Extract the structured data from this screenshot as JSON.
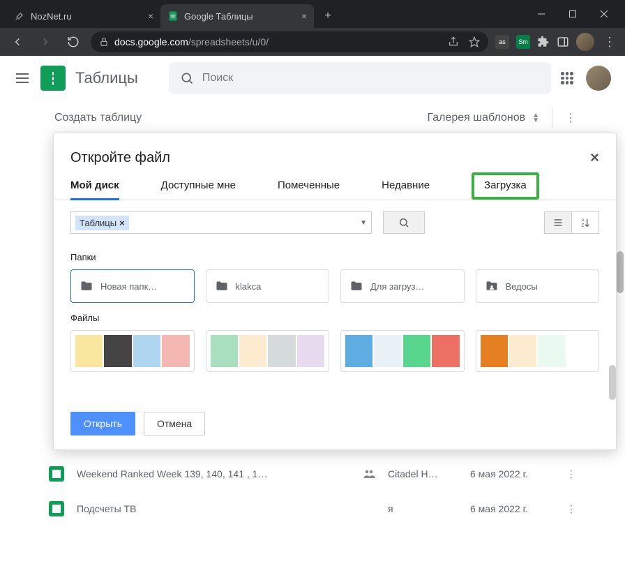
{
  "browser": {
    "tabs": [
      {
        "title": "NozNet.ru",
        "favicon": "tools"
      },
      {
        "title": "Google Таблицы",
        "favicon": "sheets"
      }
    ],
    "url_prefix": "docs.google.com",
    "url_path": "/spreadsheets/u/0/",
    "window_controls": {
      "minimize": "—",
      "maximize": "❐",
      "close": "✕"
    }
  },
  "sheets": {
    "app_name": "Таблицы",
    "search_placeholder": "Поиск",
    "create_label": "Создать таблицу",
    "gallery_label": "Галерея шаблонов"
  },
  "dialog": {
    "title": "Откройте файл",
    "tabs": [
      "Мой диск",
      "Доступные мне",
      "Помеченные",
      "Недавние",
      "Загрузка"
    ],
    "active_tab_index": 0,
    "highlight_tab_index": 4,
    "filter_chip": "Таблицы",
    "section_folders": "Папки",
    "section_files": "Файлы",
    "folders": [
      "Новая папк…",
      "klakca",
      "Для загруз…",
      "Ведосы"
    ],
    "selected_folder_index": 0,
    "buttons": {
      "open": "Открыть",
      "cancel": "Отмена"
    }
  },
  "recent_files": [
    {
      "name": "Weekend Ranked Week 139, 140, 141 , 1…",
      "owner": "Citadel H…",
      "date": "6 мая 2022 г.",
      "shared": true
    },
    {
      "name": "Подсчеты ТВ",
      "owner": "я",
      "date": "6 мая 2022 г.",
      "shared": false
    }
  ],
  "thumbnails": [
    {
      "colors": [
        "#f9e79f",
        "#444",
        "#aed6f1",
        "#f5b7b1"
      ]
    },
    {
      "colors": [
        "#a9dfbf",
        "#fdebd0",
        "#d5dbdb",
        "#e8daef"
      ]
    },
    {
      "colors": [
        "#5dade2",
        "#eaf2f8",
        "#58d68d",
        "#ec7063"
      ]
    },
    {
      "colors": [
        "#e67e22",
        "#fdebd0",
        "#eafaf1",
        "#fff"
      ]
    }
  ]
}
